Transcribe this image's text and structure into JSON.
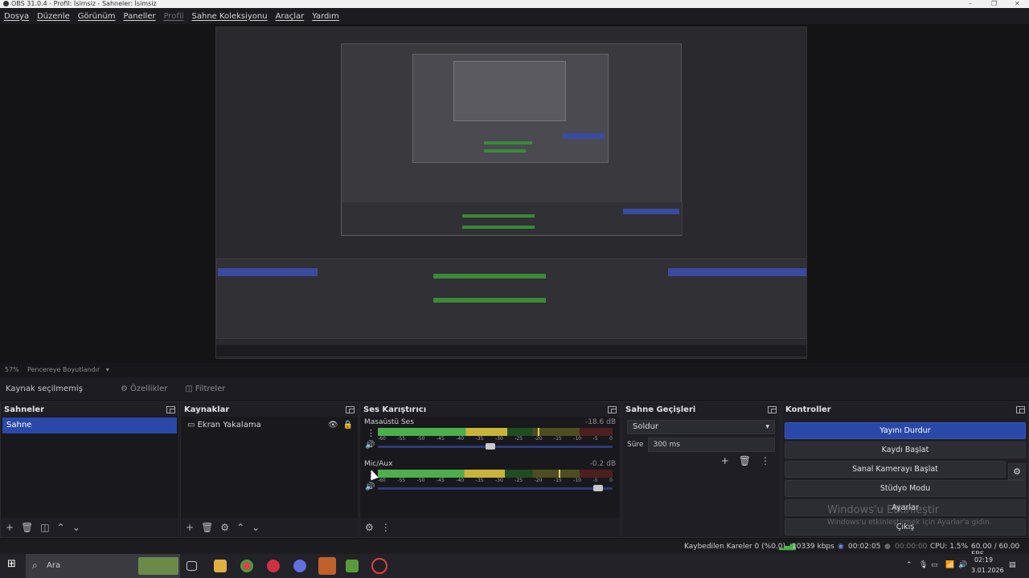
{
  "window": {
    "title": "OBS 31.0.4 - Profil: İsimsiz - Sahneler: İsimsiz"
  },
  "menu": [
    "Dosya",
    "Düzenle",
    "Görünüm",
    "Paneller",
    "Profil",
    "Sahne Koleksiyonu",
    "Araçlar",
    "Yardım"
  ],
  "preview": {
    "zoom": "57%",
    "fit_label": "Pencereye Boyutlandır"
  },
  "source_toolbar": {
    "label": "Kaynak seçilmemiş",
    "properties": "Özellikler",
    "filters": "Filtreler"
  },
  "docks": {
    "scenes": {
      "title": "Sahneler",
      "items": [
        "Sahne"
      ]
    },
    "sources": {
      "title": "Kaynaklar",
      "items": [
        "Ekran Yakalama"
      ]
    },
    "mixer": {
      "title": "Ses Karıştırıcı",
      "channels": [
        {
          "name": "Masaüstü Ses",
          "db": "-18.6 dB",
          "level": 0.55,
          "peak": 0.68,
          "volume": 0.5
        },
        {
          "name": "Mic/Aux",
          "db": "-0.2 dB",
          "level": 0.54,
          "peak": 0.77,
          "volume": 0.96
        }
      ],
      "scale": [
        "-60",
        "-55",
        "-50",
        "-45",
        "-40",
        "-35",
        "-30",
        "-25",
        "-20",
        "-15",
        "-10",
        "-5",
        "0"
      ]
    },
    "transitions": {
      "title": "Sahne Geçişleri",
      "selected": "Soldur",
      "duration_label": "Süre",
      "duration": "300 ms"
    },
    "controls": {
      "title": "Kontroller",
      "buttons": [
        "Yayını Durdur",
        "Kaydı Başlat",
        "Sanal Kamerayı Başlat",
        "Stüdyo Modu",
        "Ayarlar",
        "Çıkış"
      ]
    }
  },
  "watermark": {
    "title": "Windows'u Etkinleştir",
    "sub": "Windows'u etkinleştirmek için Ayarlar'a gidin."
  },
  "status": {
    "dropped": "Kaybedilen Kareler 0 (%0.0)",
    "bitrate": "10339 kbps",
    "stream_time": "00:02:05",
    "rec_time": "00:00:00",
    "cpu": "CPU: 1.5%",
    "fps": "60.00 / 60.00 FPS"
  },
  "taskbar": {
    "search": "Ara",
    "time": "02:19",
    "date": "3.01.2026"
  },
  "colors": {
    "accent": "#2a48a8",
    "meter_green": "#4caf4c",
    "meter_yellow": "#c9b43a"
  }
}
